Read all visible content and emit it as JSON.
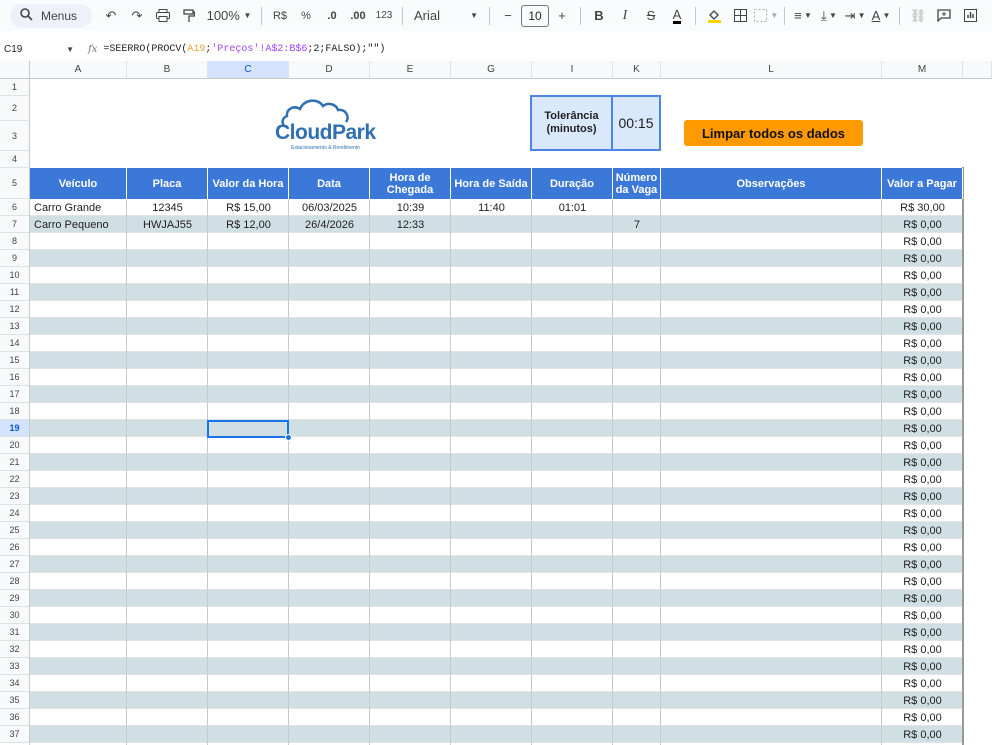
{
  "toolbar": {
    "menus_label": "Menus",
    "zoom": "100%",
    "currency": "R$",
    "percent": "%",
    "dec_less": ".0",
    "dec_more": ".00",
    "number_format": "123",
    "font": "Arial",
    "font_size": "10"
  },
  "formula_bar": {
    "cell_ref": "C19",
    "formula_prefix": "=SEERRO(PROCV(",
    "ref1": "A19",
    "sep1": ";",
    "ref2": "'Preços'!A$2:B$6",
    "formula_suffix": ";2;FALSO);\"\")"
  },
  "columns": [
    "A",
    "B",
    "C",
    "D",
    "E",
    "G",
    "I",
    "K",
    "L",
    "M"
  ],
  "rows": [
    "1",
    "2",
    "3",
    "4",
    "5",
    "6",
    "7",
    "8",
    "9",
    "10",
    "11",
    "12",
    "13",
    "14",
    "15",
    "16",
    "17",
    "18",
    "19",
    "20",
    "21",
    "22",
    "23",
    "24",
    "25",
    "26",
    "27",
    "28",
    "29",
    "30",
    "31",
    "32",
    "33",
    "34",
    "35",
    "36",
    "37"
  ],
  "logo": {
    "name": "CloudPark",
    "tagline": "Estacionamento & Rendimento"
  },
  "tolerance": {
    "label": "Tolerância (minutos)",
    "value": "00:15"
  },
  "clear_button": "Limpar todos os dados",
  "table": {
    "headers": [
      "Veículo",
      "Placa",
      "Valor da Hora",
      "Data",
      "Hora de Chegada",
      "Hora de Saída",
      "Duração",
      "Número da Vaga",
      "Observações",
      "Valor a Pagar"
    ],
    "rows": [
      [
        "Carro Grande",
        "12345",
        "R$ 15,00",
        "06/03/2025",
        "10:39",
        "11:40",
        "01:01",
        "",
        "",
        "R$ 30,00"
      ],
      [
        "Carro Pequeno",
        "HWJAJ55",
        "R$ 12,00",
        "26/4/2026",
        "12:33",
        "",
        "",
        "7",
        "",
        "R$ 0,00"
      ]
    ],
    "empty_value": "R$ 0,00"
  },
  "colors": {
    "header_blue": "#3c78d8",
    "band": "#d0dfe3",
    "button": "#ff9900",
    "selection": "#1a73e8"
  }
}
